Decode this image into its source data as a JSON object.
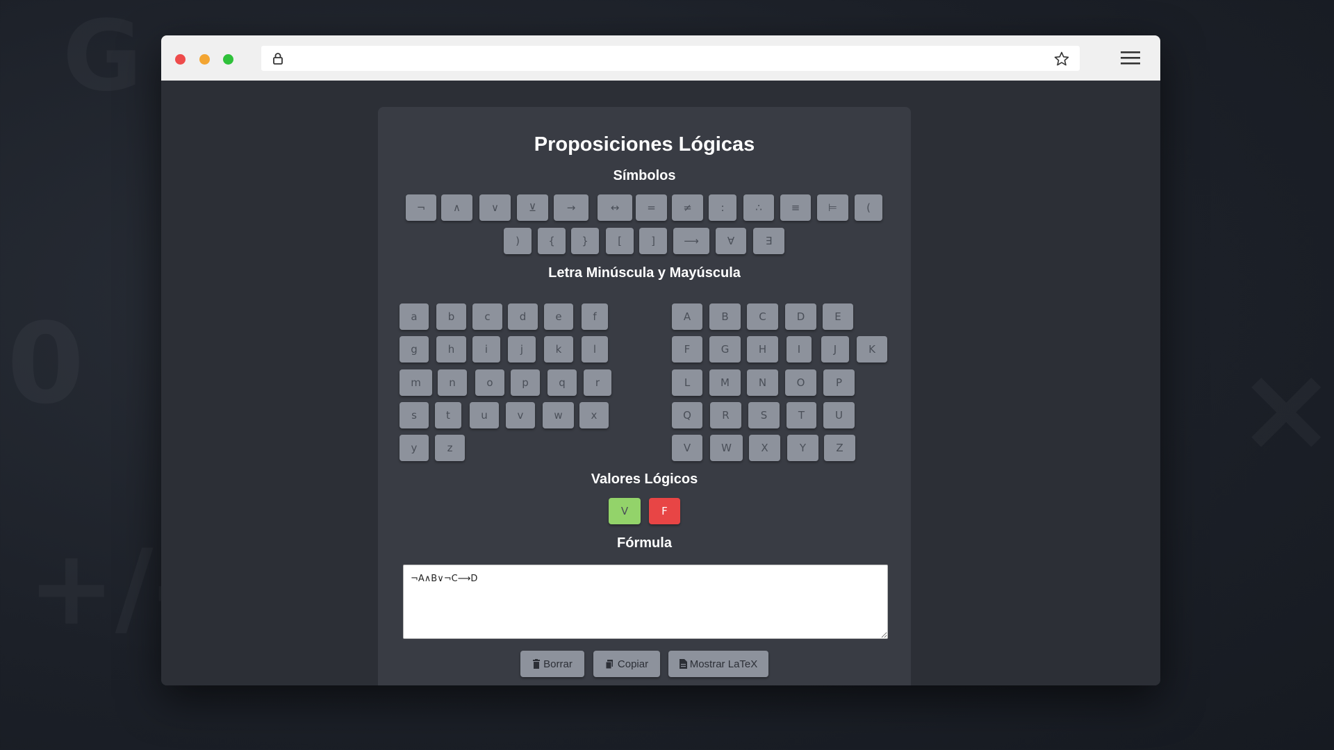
{
  "app": {
    "title": "Proposiciones Lógicas"
  },
  "sections": {
    "symbols": "Símbolos",
    "letters": "Letra Minúscula y Mayúscula",
    "values": "Valores Lógicos",
    "formula": "Fórmula"
  },
  "symbols_row1": [
    "¬",
    "∧",
    "∨",
    "⊻",
    "→",
    "↔",
    "=",
    "≠",
    ":",
    "∴",
    "≡",
    "⊨",
    "("
  ],
  "symbols_row2": [
    ")",
    "{",
    "}",
    "[",
    "]",
    "⟶",
    "∀",
    "∃"
  ],
  "lowercase": [
    [
      "a",
      "b",
      "c",
      "d",
      "e",
      "f"
    ],
    [
      "g",
      "h",
      "i",
      "j",
      "k",
      "l"
    ],
    [
      "m",
      "n",
      "o",
      "p",
      "q",
      "r"
    ],
    [
      "s",
      "t",
      "u",
      "v",
      "w",
      "x"
    ],
    [
      "y",
      "z"
    ]
  ],
  "uppercase": [
    [
      "A",
      "B",
      "C",
      "D",
      "E"
    ],
    [
      "F",
      "G",
      "H",
      "I",
      "J",
      "K"
    ],
    [
      "L",
      "M",
      "N",
      "O",
      "P"
    ],
    [
      "Q",
      "R",
      "S",
      "T",
      "U"
    ],
    [
      "V",
      "W",
      "X",
      "Y",
      "Z"
    ]
  ],
  "truth_values": {
    "true_label": "V",
    "false_label": "F"
  },
  "formula": {
    "value": "¬A∧B∨¬C⟶D"
  },
  "actions": {
    "clear_label": "Borrar",
    "copy_label": "Copiar",
    "latex_label": "Mostrar LaTeX"
  },
  "icons": {
    "clear": "trash-icon",
    "copy": "clipboard-icon",
    "latex": "document-icon"
  },
  "colors": {
    "true_button": "#93d36a",
    "false_button": "#e84545",
    "key": "#8d929c",
    "card": "#393c44"
  }
}
